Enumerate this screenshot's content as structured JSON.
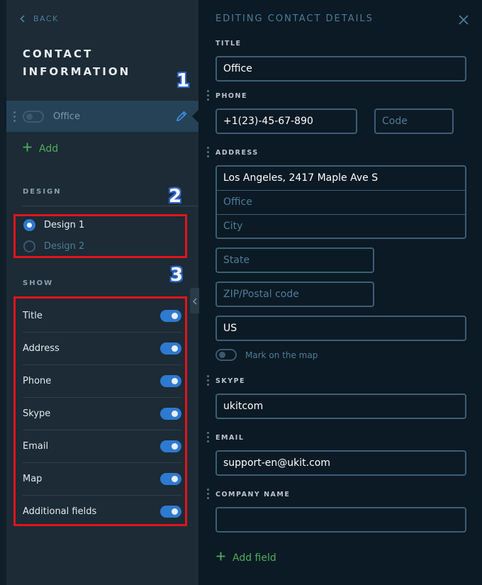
{
  "left_panel": {
    "back_label": "BACK",
    "title": "CONTACT INFORMATION",
    "contact_item": {
      "label": "Office",
      "enabled": false
    },
    "add_label": "Add",
    "design": {
      "label": "DESIGN",
      "options": [
        {
          "label": "Design 1",
          "selected": true
        },
        {
          "label": "Design 2",
          "selected": false
        }
      ]
    },
    "show": {
      "label": "SHOW",
      "items": [
        {
          "label": "Title",
          "on": true
        },
        {
          "label": "Address",
          "on": true
        },
        {
          "label": "Phone",
          "on": true
        },
        {
          "label": "Skype",
          "on": true
        },
        {
          "label": "Email",
          "on": true
        },
        {
          "label": "Map",
          "on": true
        },
        {
          "label": "Additional fields",
          "on": true
        }
      ]
    }
  },
  "annotations": [
    "1",
    "2",
    "3"
  ],
  "right_panel": {
    "title": "EDITING CONTACT DETAILS",
    "title_field": {
      "label": "TITLE",
      "value": "Office"
    },
    "phone": {
      "label": "PHONE",
      "value": "+1(23)-45-67-890",
      "code_placeholder": "Code"
    },
    "address": {
      "label": "ADDRESS",
      "street": "Los Angeles, 2417 Maple Ave S",
      "office_placeholder": "Office",
      "city_placeholder": "City",
      "state_placeholder": "State",
      "zip_placeholder": "ZIP/Postal code",
      "country": "US",
      "map_label": "Mark on the map",
      "map_enabled": false
    },
    "skype": {
      "label": "SKYPE",
      "value": "ukitcom"
    },
    "email": {
      "label": "EMAIL",
      "value": "support-en@ukit.com"
    },
    "company": {
      "label": "COMPANY NAME",
      "value": ""
    },
    "add_field_label": "Add field"
  },
  "colors": {
    "accent_blue": "#2e7ad0",
    "add_green": "#4fae5c",
    "annotation_red": "#e0141c",
    "annotation_badge": "#2d63c8"
  }
}
